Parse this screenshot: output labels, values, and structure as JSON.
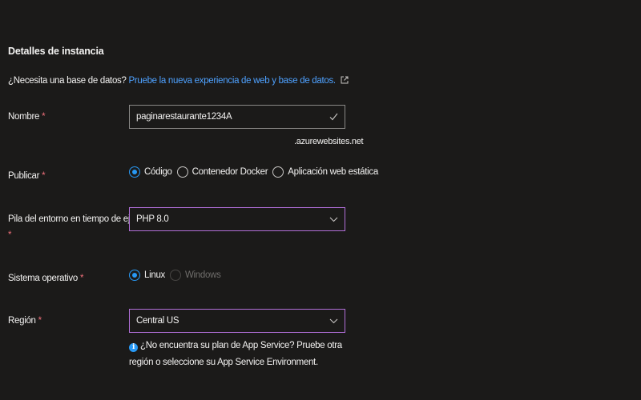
{
  "section": {
    "title": "Detalles de instancia",
    "db_question": "¿Necesita una base de datos?",
    "db_link": "Pruebe la nueva experiencia de web y base de datos."
  },
  "name": {
    "label": "Nombre",
    "required": "*",
    "value": "paginarestaurante1234A",
    "valid_icon": "checkmark-icon",
    "suffix": ".azurewebsites.net"
  },
  "publish": {
    "label": "Publicar",
    "required": "*",
    "options": [
      "Código",
      "Contenedor Docker",
      "Aplicación web estática"
    ],
    "selected": "Código"
  },
  "runtime": {
    "label": "Pila del entorno en tiempo de ejecución",
    "required": "*",
    "value": "PHP 8.0"
  },
  "os": {
    "label": "Sistema operativo",
    "required": "*",
    "options": [
      "Linux",
      "Windows"
    ],
    "selected": "Linux",
    "disabled": "Windows"
  },
  "region": {
    "label": "Región",
    "required": "*",
    "value": "Central US",
    "info_text": "¿No encuentra su plan de App Service? Pruebe otra región o seleccione su App Service Environment."
  },
  "colors": {
    "background": "#1b1a19",
    "link": "#4ea1ff",
    "required": "#f1707b",
    "accent": "#2899f5",
    "focus_border": "#b16fd8"
  }
}
